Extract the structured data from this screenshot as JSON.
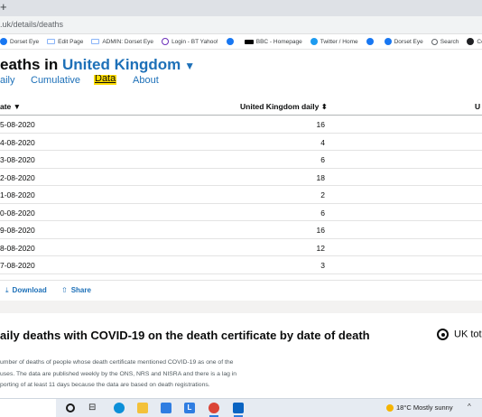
{
  "browser": {
    "new_tab_glyph": "+",
    "url": ".uk/details/deaths",
    "bookmarks": [
      {
        "icon": "facebook-icon",
        "label": "Dorset Eye",
        "cls": "fb"
      },
      {
        "icon": "wordpress-icon",
        "label": "Edit Page",
        "cls": "wp"
      },
      {
        "icon": "wordpress-icon",
        "label": "ADMIN: Dorset Eye",
        "cls": "wp"
      },
      {
        "icon": "yahoo-icon",
        "label": "Login - BT Yahoo!",
        "cls": "yh"
      },
      {
        "icon": "facebook-icon",
        "label": "",
        "cls": "fb"
      },
      {
        "icon": "bbc-icon",
        "label": "BBC - Homepage",
        "cls": "bbc"
      },
      {
        "icon": "twitter-icon",
        "label": "Twitter / Home",
        "cls": "tw"
      },
      {
        "icon": "facebook-icon",
        "label": "",
        "cls": "fb"
      },
      {
        "icon": "facebook-icon",
        "label": "Dorset Eye",
        "cls": "fb"
      },
      {
        "icon": "search-icon",
        "label": "Search",
        "cls": "srch"
      },
      {
        "icon": "site-icon",
        "label": "Com",
        "cls": "com"
      }
    ]
  },
  "page": {
    "title_prefix": "eaths in ",
    "title_country": "United Kingdom",
    "caret": "▼",
    "tabs": [
      {
        "label": "aily",
        "active": false
      },
      {
        "label": "Cumulative",
        "active": false
      },
      {
        "label": "Data",
        "active": true
      },
      {
        "label": "About",
        "active": false
      }
    ]
  },
  "table": {
    "headers": {
      "date": "ate ▼",
      "uk_daily": "United Kingdom daily  ⬍",
      "third": "U"
    },
    "rows": [
      {
        "date": "5-08-2020",
        "value": "16"
      },
      {
        "date": "4-08-2020",
        "value": "4"
      },
      {
        "date": "3-08-2020",
        "value": "6"
      },
      {
        "date": "2-08-2020",
        "value": "18"
      },
      {
        "date": "1-08-2020",
        "value": "2"
      },
      {
        "date": "0-08-2020",
        "value": "6"
      },
      {
        "date": "9-08-2020",
        "value": "16"
      },
      {
        "date": "8-08-2020",
        "value": "12"
      },
      {
        "date": "7-08-2020",
        "value": "3"
      }
    ]
  },
  "actions": {
    "download_label": "Download",
    "share_label": "Share",
    "download_glyph": "⤓",
    "share_glyph": "⇧"
  },
  "section": {
    "title": "aily deaths with COVID-19 on the death certificate by date of death",
    "radio_label": "UK tot",
    "description_lines": [
      "umber of deaths of people whose death certificate mentioned COVID-19 as one of the",
      "uses. The data are published weekly by the ONS, NRS and NISRA and there is a lag in",
      "porting of at least 11 days because the data are based on death registrations."
    ]
  },
  "taskbar": {
    "weather": "18°C  Mostly sunny",
    "tray_glyph": "^"
  },
  "colors": {
    "link": "#1d70b8",
    "focus": "#ffdd00",
    "text": "#0b0c0c"
  }
}
